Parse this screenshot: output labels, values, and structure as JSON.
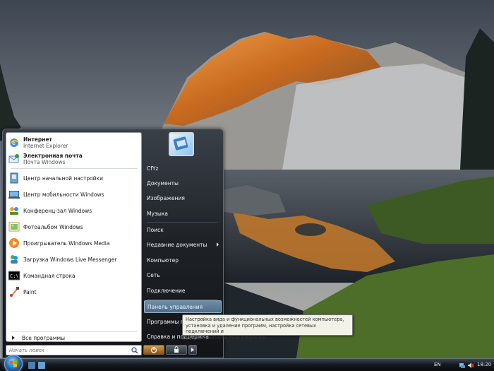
{
  "start_menu": {
    "pinned": [
      {
        "title": "Интернет",
        "subtitle": "Internet Explorer",
        "icon": "internet-explorer-icon"
      },
      {
        "title": "Электронная почта",
        "subtitle": "Почта Windows",
        "icon": "windows-mail-icon"
      }
    ],
    "recent": [
      {
        "label": "Центр начальной настройки",
        "icon": "welcome-center-icon"
      },
      {
        "label": "Центр мобильности Windows",
        "icon": "mobility-center-icon"
      },
      {
        "label": "Конференц-зал Windows",
        "icon": "meeting-space-icon"
      },
      {
        "label": "Фотоальбом Windows",
        "icon": "photo-gallery-icon"
      },
      {
        "label": "Проигрыватель Windows Media",
        "icon": "media-player-icon"
      },
      {
        "label": "Загрузка Windows Live Messenger",
        "icon": "messenger-icon"
      },
      {
        "label": "Командная строка",
        "icon": "command-prompt-icon"
      },
      {
        "label": "Paint",
        "icon": "paint-icon"
      }
    ],
    "all_programs_label": "Все программы",
    "search_placeholder": "Начать поиск",
    "right_items": [
      {
        "label": "CfYz"
      },
      {
        "label": "Документы"
      },
      {
        "label": "Изображения"
      },
      {
        "label": "Музыка"
      },
      {
        "label": "Поиск"
      },
      {
        "label": "Недавние документы"
      },
      {
        "label": "Компьютер"
      },
      {
        "label": "Сеть"
      },
      {
        "label": "Подключение"
      },
      {
        "label": "Панель управления"
      },
      {
        "label": "Программы по"
      },
      {
        "label": "Справка и поддержка"
      }
    ],
    "highlighted_item": "Панель управления"
  },
  "tooltip": {
    "line1": "Настройка вида и функциональных возможностей компьютера,",
    "line2": "установка и удаление программ, настройка сетевых подключений и",
    "line3": "учетных записей пользователей."
  },
  "taskbar": {
    "language": "EN",
    "clock": "18:20"
  },
  "colors": {
    "accent": "#4c6d88",
    "orb": "#2b6fb8"
  }
}
